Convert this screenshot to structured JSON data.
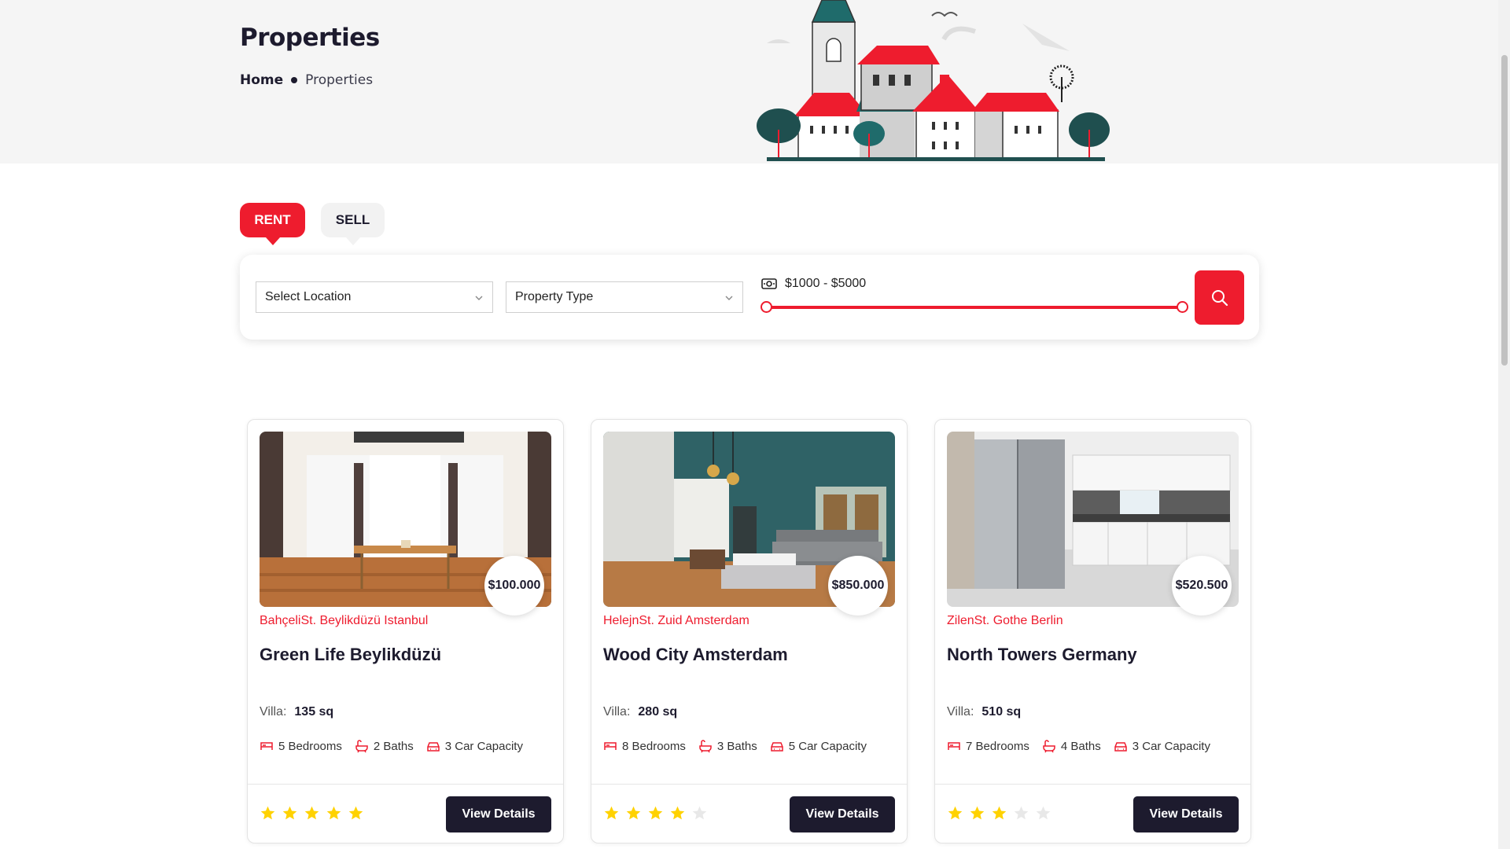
{
  "header": {
    "title": "Properties",
    "breadcrumb": {
      "home": "Home",
      "current": "Properties"
    }
  },
  "search": {
    "tabs": [
      {
        "label": "RENT",
        "active": true
      },
      {
        "label": "SELL",
        "active": false
      }
    ],
    "location_placeholder": "Select Location",
    "type_placeholder": "Property Type",
    "price_range_label": "$1000 - $5000",
    "price_min": 1000,
    "price_max": 5000,
    "search_icon": "search-icon"
  },
  "listings": [
    {
      "price": "$100.000",
      "location": "BahçeliSt. Beylikdüzü Istanbul",
      "title": "Green Life Beylikdüzü",
      "type_label": "Villa:",
      "size": "135 sq",
      "bedrooms": "5 Bedrooms",
      "baths": "2 Baths",
      "car": "3 Car Capacity",
      "rating": 5,
      "button": "View Details"
    },
    {
      "price": "$850.000",
      "location": "HelejnSt. Zuid Amsterdam",
      "title": "Wood City Amsterdam",
      "type_label": "Villa:",
      "size": "280 sq",
      "bedrooms": "8 Bedrooms",
      "baths": "3 Baths",
      "car": "5 Car Capacity",
      "rating": 4,
      "button": "View Details"
    },
    {
      "price": "$520.500",
      "location": "ZilenSt. Gothe Berlin",
      "title": "North Towers Germany",
      "type_label": "Villa:",
      "size": "510 sq",
      "bedrooms": "7 Bedrooms",
      "baths": "4 Baths",
      "car": "3 Car Capacity",
      "rating": 3,
      "button": "View Details"
    }
  ],
  "colors": {
    "accent": "#ee1c2e",
    "dark": "#1d1b2e",
    "star_filled": "#ffd200",
    "star_empty": "#e8e8e8",
    "hero_bg": "#f5f5f5"
  }
}
